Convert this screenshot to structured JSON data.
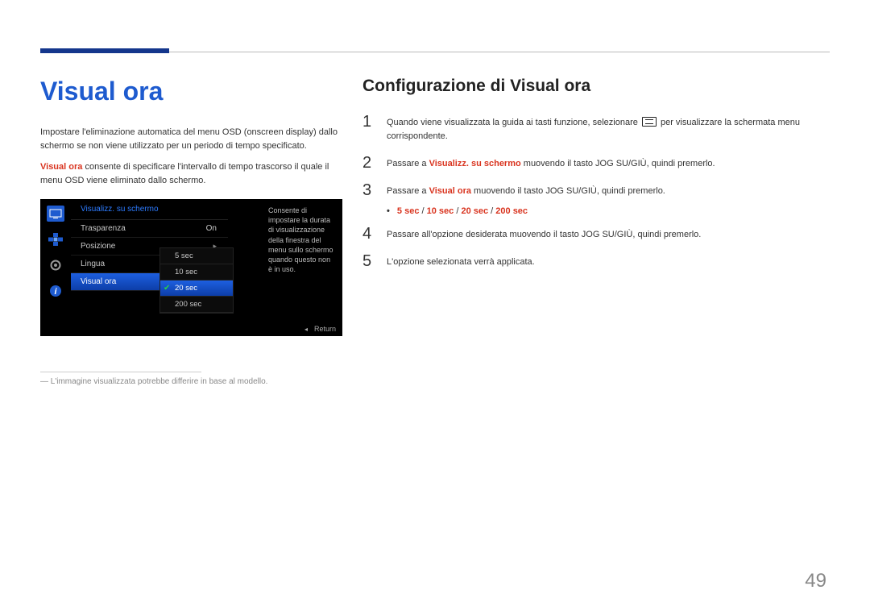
{
  "page_number": "49",
  "left": {
    "heading": "Visual ora",
    "p1": "Impostare l'eliminazione automatica del menu OSD (onscreen display) dallo schermo se non viene utilizzato per un periodo di tempo specificato.",
    "p2_hl": "Visual ora",
    "p2_rest": " consente di specificare l'intervallo di tempo trascorso il quale il menu OSD viene eliminato dallo schermo.",
    "footnote": "L'immagine visualizzata potrebbe differire in base al modello."
  },
  "osd": {
    "title": "Visualizz. su schermo",
    "rows": [
      {
        "label": "Trasparenza",
        "value": "On"
      },
      {
        "label": "Posizione",
        "value": "arrow"
      },
      {
        "label": "Lingua",
        "value": "arrow"
      },
      {
        "label": "Visual ora",
        "value": "",
        "selected": true
      }
    ],
    "options": [
      {
        "label": "5 sec"
      },
      {
        "label": "10 sec"
      },
      {
        "label": "20 sec",
        "selected": true
      },
      {
        "label": "200 sec"
      }
    ],
    "help": "Consente di impostare la durata di visualizzazione della finestra del menu sullo schermo quando questo non è in uso.",
    "return": "Return"
  },
  "right": {
    "heading": "Configurazione di Visual ora",
    "steps": {
      "s1_a": "Quando viene visualizzata la guida ai tasti funzione, selezionare ",
      "s1_b": " per visualizzare la schermata menu corrispondente.",
      "s2_a": "Passare a ",
      "s2_hl": "Visualizz. su schermo",
      "s2_b": " muovendo il tasto JOG SU/GIÙ, quindi premerlo.",
      "s3_a": "Passare a ",
      "s3_hl": "Visual ora",
      "s3_b": " muovendo il tasto JOG SU/GIÙ, quindi premerlo.",
      "s4": "Passare all'opzione desiderata muovendo il tasto JOG SU/GIÙ, quindi premerlo.",
      "s5": "L'opzione selezionata verrà applicata."
    },
    "options_line": {
      "o1": "5 sec",
      "o2": "10 sec",
      "o3": "20 sec",
      "o4": "200 sec",
      "sep": " / "
    }
  }
}
